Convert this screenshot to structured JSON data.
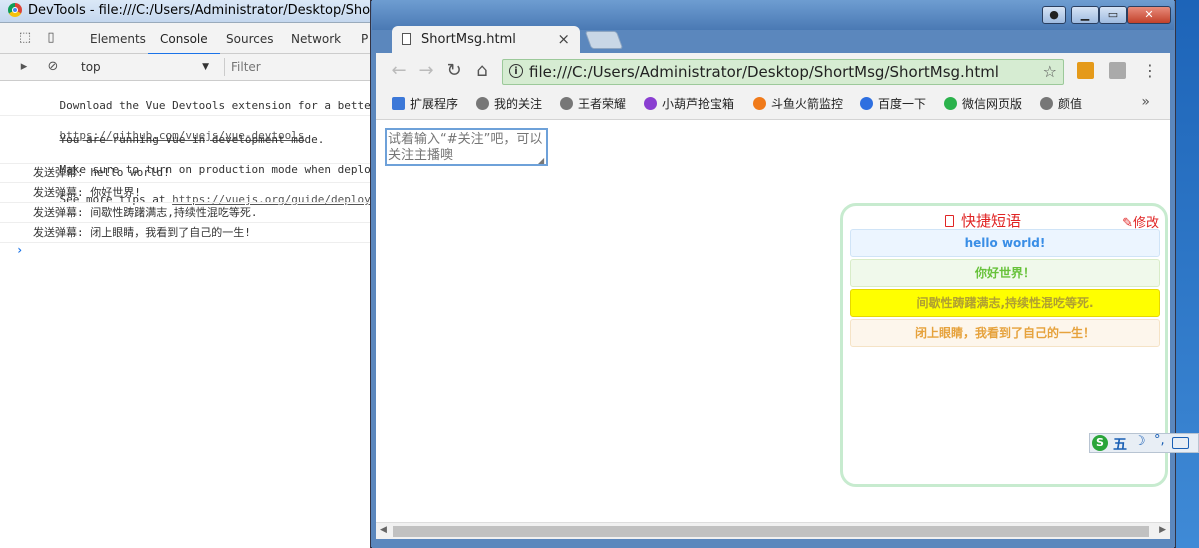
{
  "devtools": {
    "window_title": "DevTools - file:///C:/Users/Administrator/Desktop/ShortMs",
    "tabs": [
      "Elements",
      "Console",
      "Sources",
      "Network",
      "P"
    ],
    "active_tab": "Console",
    "context": "top",
    "filter_placeholder": "Filter",
    "console": {
      "msg1_line1": "Download the Vue Devtools extension for a better de",
      "msg1_link": "https://github.com/vuejs/vue-devtools",
      "msg2_line1": "You are running Vue in development mode.",
      "msg2_line2": "Make sure to turn on production mode when deploying",
      "msg2_line3_prefix": "See more tips at ",
      "msg2_link": "https://vuejs.org/guide/deployment",
      "logs": [
        "发送弹幕: hello world!",
        "发送弹幕: 你好世界!",
        "发送弹幕: 间歇性踌躇满志,持续性混吃等死.",
        "发送弹幕: 闭上眼睛，我看到了自己的一生!"
      ],
      "prompt": "›"
    }
  },
  "browser": {
    "tab_title": "ShortMsg.html",
    "url": "file:///C:/Users/Administrator/Desktop/ShortMsg/ShortMsg.html",
    "bookmarks": [
      "扩展程序",
      "我的关注",
      "王者荣耀",
      "小葫芦抢宝箱",
      "斗鱼火箭监控",
      "百度一下",
      "微信网页版",
      "颜值"
    ],
    "bookmark_more": "»"
  },
  "page": {
    "input_placeholder": "试着输入“#关注”吧，可以关注主播噢",
    "panel_title": "快捷短语",
    "edit_label": "修改",
    "phrases": [
      {
        "text": "hello world!",
        "color": "#3a8ee6",
        "bg": "#ecf5ff",
        "border": "#d0e4f7"
      },
      {
        "text": "你好世界！",
        "color": "#67c23a",
        "bg": "#f0f9eb",
        "border": "#d8ecc8"
      },
      {
        "text": "间歇性踌躇满志,持续性混吃等死.",
        "color": "#b0a030",
        "bg": "#ffff00",
        "border": "#e6d800"
      },
      {
        "text": "闭上眼睛，我看到了自己的一生！",
        "color": "#e6a23c",
        "bg": "#fdf6ec",
        "border": "#f5e3c6"
      }
    ]
  },
  "ime": {
    "logo": "S",
    "mode": "五",
    "moon": "☽",
    "punct": "°,"
  }
}
